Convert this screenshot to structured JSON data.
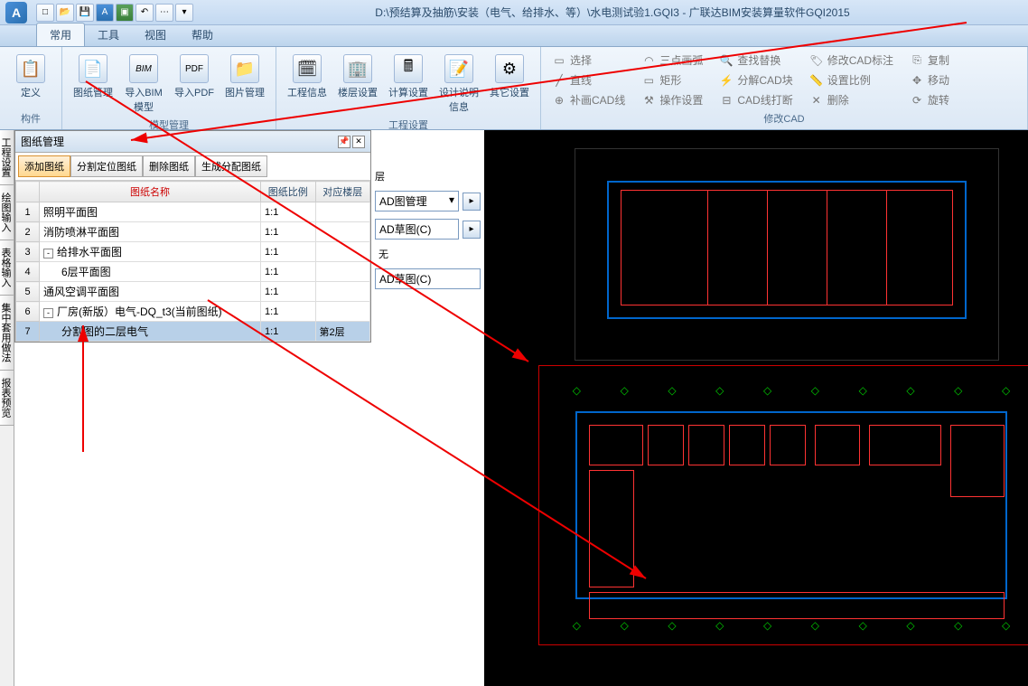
{
  "title": "D:\\预结算及抽筋\\安装（电气、给排水、等）\\水电测试验1.GQI3 - 广联达BIM安装算量软件GQI2015",
  "app_letter": "A",
  "qat_icons": [
    "new-icon",
    "open-icon",
    "save-icon",
    "a-icon",
    "layer-icon",
    "undo-icon",
    "redo-icon",
    "dropdown-icon"
  ],
  "tabs": {
    "t0": "常用",
    "t1": "工具",
    "t2": "视图",
    "t3": "帮助"
  },
  "ribbon": {
    "g_component": {
      "label": "构件",
      "define": "定义"
    },
    "g_model": {
      "label": "模型管理",
      "paper_mgr": "图纸管理",
      "import_bim": "导入BIM模型",
      "import_pdf": "导入PDF",
      "pic_mgr": "图片管理"
    },
    "g_project": {
      "label": "工程设置",
      "proj_info": "工程信息",
      "floor_set": "楼层设置",
      "calc_set": "计算设置",
      "design_info": "设计说明信息",
      "other_set": "其它设置"
    },
    "g_modcad": {
      "label": "修改CAD",
      "select": "选择",
      "three_arc": "三点画弧",
      "find": "查找替换",
      "mod_label": "修改CAD标注",
      "copy": "复制",
      "line": "直线",
      "rect": "矩形",
      "split_cad": "分解CAD块",
      "set_scale": "设置比例",
      "move": "移动",
      "fill_cad": "补画CAD线",
      "op_set": "操作设置",
      "cad_break": "CAD线打断",
      "delete": "删除",
      "rotate": "旋转"
    }
  },
  "vside": {
    "v0": "工程设置",
    "v1": "绘图输入",
    "v2": "表格输入",
    "v3": "集中套用做法",
    "v4": "报表预览"
  },
  "panel": {
    "title": "图纸管理",
    "btns": {
      "add": "添加图纸",
      "split": "分割定位图纸",
      "del": "删除图纸",
      "gen": "生成分配图纸"
    },
    "cols": {
      "name": "图纸名称",
      "scale": "图纸比例",
      "floor": "对应楼层"
    },
    "rows": [
      {
        "n": "1",
        "name": "照明平面图",
        "scale": "1:1",
        "floor": "",
        "indent": 0
      },
      {
        "n": "2",
        "name": "消防喷淋平面图",
        "scale": "1:1",
        "floor": "",
        "indent": 0
      },
      {
        "n": "3",
        "name": "给排水平面图",
        "scale": "1:1",
        "floor": "",
        "indent": 0,
        "toggle": "-"
      },
      {
        "n": "4",
        "name": "6层平面图",
        "scale": "1:1",
        "floor": "",
        "indent": 1
      },
      {
        "n": "5",
        "name": "通风空调平面图",
        "scale": "1:1",
        "floor": "",
        "indent": 0
      },
      {
        "n": "6",
        "name": "厂房(新版）电气-DQ_t3(当前图纸)",
        "scale": "1:1",
        "floor": "",
        "indent": 0,
        "toggle": "-"
      },
      {
        "n": "7",
        "name": "分割图的二层电气",
        "scale": "1:1",
        "floor": "第2层",
        "indent": 1,
        "selected": true
      }
    ]
  },
  "mid": {
    "floor_label": "层",
    "cad_mgr": "AD图管理",
    "sketch1": "AD草图(C)",
    "sketch2": "AD草图(C)",
    "none": "无"
  }
}
